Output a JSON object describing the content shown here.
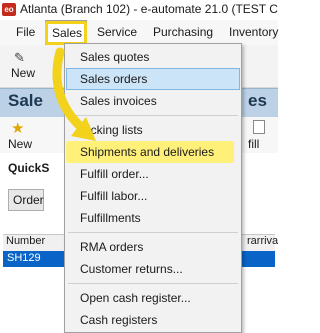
{
  "window": {
    "logo_text": "eo",
    "title": "Atlanta (Branch 102) - e-automate 21.0  (TEST CO"
  },
  "menubar": {
    "items": [
      "File",
      "Sales",
      "Service",
      "Purchasing",
      "Inventory"
    ],
    "active": "Sales"
  },
  "toolbar": {
    "new_label": "New"
  },
  "section": {
    "title_left": "Sale",
    "title_right": "es"
  },
  "subtoolbar": {
    "new_label": "New",
    "fill_label": "fill"
  },
  "quicksearch": {
    "label": "QuickS",
    "order_button": "Order"
  },
  "grid": {
    "col_number": "Number",
    "col_arrival": "rarriva",
    "selected_row_number": "SH129"
  },
  "sales_menu": {
    "items": [
      "Sales quotes",
      "Sales orders",
      "Sales invoices",
      "Picking lists",
      "Shipments and deliveries",
      "Fulfill order...",
      "Fulfill labor...",
      "Fulfillments",
      "RMA orders",
      "Customer returns...",
      "Open cash register...",
      "Cash registers"
    ],
    "hovered": "Sales orders",
    "highlighted": "Shipments and deliveries"
  },
  "colors": {
    "highlight": "#f2d21b",
    "menu_hover": "#cce4f7",
    "selected_row": "#0a64c8",
    "header_band": "#bcd1e6"
  }
}
